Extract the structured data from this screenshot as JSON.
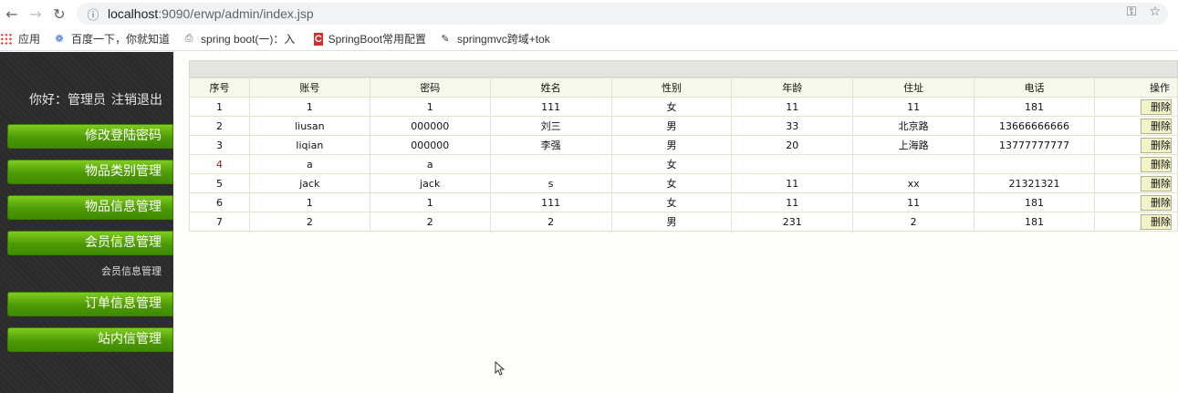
{
  "browser": {
    "url_host": "localhost",
    "url_rest": ":9090/erwp/admin/index.jsp",
    "bookmarks": [
      "应用",
      "百度一下，你就知道",
      "spring boot(一)：入",
      "SpringBoot常用配置",
      "springmvc跨域+tok"
    ]
  },
  "sidebar": {
    "welcome": "你好：管理员",
    "logout": "注销退出",
    "menu": [
      "修改登陆密码",
      "物品类别管理",
      "物品信息管理",
      "会员信息管理",
      "订单信息管理",
      "站内信管理"
    ],
    "submenu": "会员信息管理"
  },
  "table": {
    "headers": [
      "序号",
      "账号",
      "密码",
      "姓名",
      "性别",
      "年龄",
      "住址",
      "电话",
      "操作"
    ],
    "delete_label": "删除",
    "rows": [
      [
        "1",
        "1",
        "1",
        "111",
        "女",
        "11",
        "11",
        "181"
      ],
      [
        "2",
        "liusan",
        "000000",
        "刘三",
        "男",
        "33",
        "北京路",
        "13666666666"
      ],
      [
        "3",
        "liqian",
        "000000",
        "李强",
        "男",
        "20",
        "上海路",
        "13777777777"
      ],
      [
        "4",
        "a",
        "a",
        "",
        "女",
        "",
        "",
        ""
      ],
      [
        "5",
        "jack",
        "jack",
        "s",
        "女",
        "11",
        "xx",
        "21321321"
      ],
      [
        "6",
        "1",
        "1",
        "111",
        "女",
        "11",
        "11",
        "181"
      ],
      [
        "7",
        "2",
        "2",
        "2",
        "男",
        "231",
        "2",
        "181"
      ]
    ]
  }
}
